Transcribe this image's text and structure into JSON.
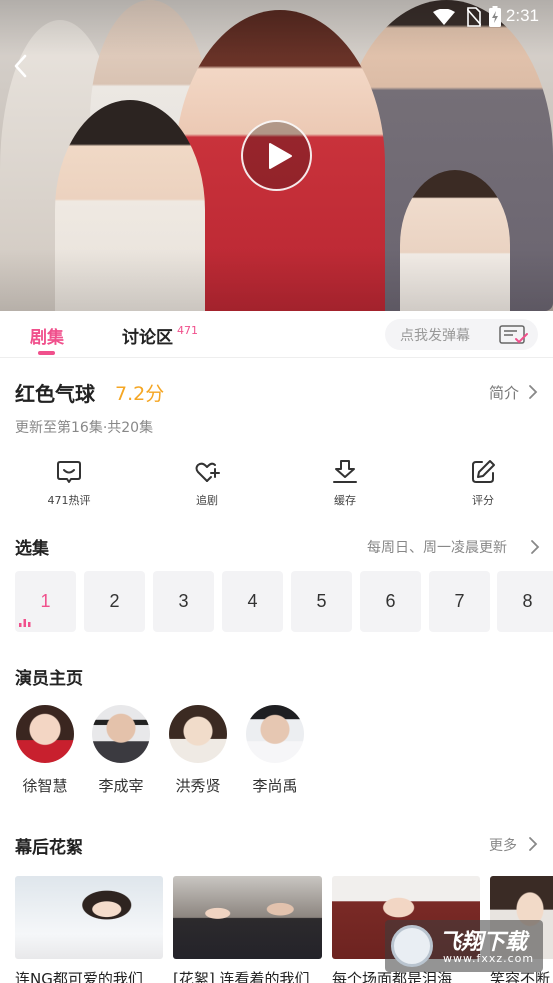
{
  "status": {
    "time": "2:31"
  },
  "player": {
    "back_icon": "chevron-left-icon",
    "play_icon": "play-icon"
  },
  "tabs": [
    {
      "label": "剧集",
      "active": true
    },
    {
      "label": "讨论区",
      "count": "471",
      "active": false
    }
  ],
  "danmu": {
    "placeholder": "点我发弹幕",
    "icon": "danmu-settings-icon"
  },
  "show": {
    "title": "红色气球",
    "score": "7.2分",
    "intro_label": "简介",
    "update_text": "更新至第16集·共20集"
  },
  "actions": [
    {
      "label": "471热评",
      "icon": "comment-icon"
    },
    {
      "label": "追剧",
      "icon": "heart-plus-icon"
    },
    {
      "label": "缓存",
      "icon": "download-icon"
    },
    {
      "label": "评分",
      "icon": "edit-icon"
    }
  ],
  "episodes": {
    "title": "选集",
    "schedule": "每周日、周一凌晨更新",
    "items": [
      "1",
      "2",
      "3",
      "4",
      "5",
      "6",
      "7",
      "8"
    ],
    "active_index": 0
  },
  "actors": {
    "title": "演员主页",
    "items": [
      {
        "name": "徐智慧"
      },
      {
        "name": "李成宰"
      },
      {
        "name": "洪秀贤"
      },
      {
        "name": "李尚禹"
      }
    ]
  },
  "bts": {
    "title": "幕后花絮",
    "more_label": "更多",
    "items": [
      {
        "caption": "连NG都可爱的我们"
      },
      {
        "caption": "[花絮] 连看着的我们"
      },
      {
        "caption": "每个场面都是泪海"
      },
      {
        "caption": "笑容不断"
      }
    ]
  },
  "watermark": {
    "text": "飞翔下载",
    "sub": "www.fxxz.com"
  },
  "colors": {
    "accent": "#f0508c",
    "score": "#f5a623"
  }
}
